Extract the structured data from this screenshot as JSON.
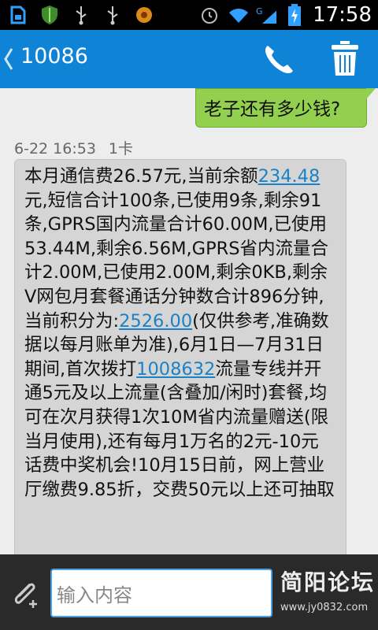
{
  "status_bar": {
    "time": "17:58",
    "left_icons": [
      "sim-card-icon",
      "shield-icon",
      "usb-icon",
      "usb-icon",
      "recorder-icon"
    ],
    "right_icons": [
      "alarm-clock-icon",
      "wifi-icon",
      "signal-icon",
      "battery-charging-icon"
    ]
  },
  "header": {
    "title": "10086",
    "accent_color": "#0f84d6"
  },
  "messages": {
    "outgoing": {
      "text": "老子还有多少钱?"
    },
    "incoming": {
      "timestamp": "6-22 16:53",
      "sim": "1卡",
      "part1": "本月通信费26.57元,当前余额",
      "balance_link": "234.48",
      "part2": "元,短信合计100条,已使用9条,剩余91条,GPRS国内流量合计60.00M,已使用53.44M,剩余6.56M,GPRS省内流量合计2.00M,已使用2.00M,剩余0KB,剩余V网包月套餐通话分钟数合计896分钟,当前积分为:",
      "points_link": "2526.00",
      "part3": "(仅供参考,准确数据以每月账单为准),6月1日—7月31日期间,首次拨打",
      "phone_link": "1008632",
      "part4": "流量专线并开通5元及以上流量(含叠加/闲时)套餐,均可在次月获得1次10M省内流量赠送(限当月使用),还有每月1万名的2元-10元话费中奖机会!10月15日前，网上营业厅缴费9.85折，交费50元以上还可抽取"
    }
  },
  "compose": {
    "placeholder": "输入内容"
  },
  "watermark": {
    "title": "简阳论坛",
    "url": "www.jy0832.com"
  }
}
